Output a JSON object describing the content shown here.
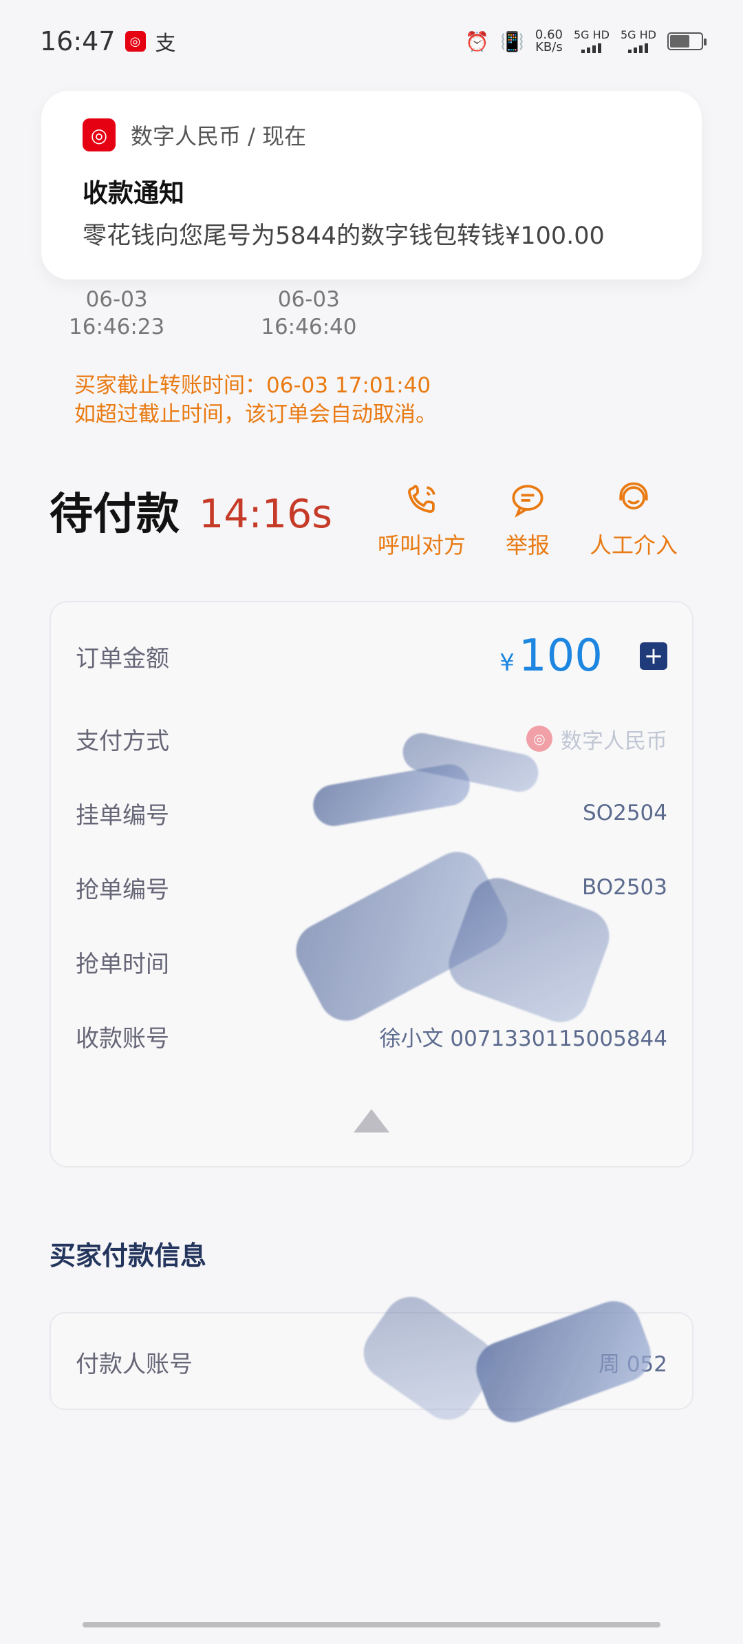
{
  "status_bar": {
    "time": "16:47",
    "app_badge": "",
    "alipay_char": "支",
    "speed_value": "0.60",
    "speed_unit": "KB/s",
    "sim1_label": "5G HD",
    "sim2_label": "5G HD"
  },
  "notification": {
    "app_name": "数字人民币 / 现在",
    "title": "收款通知",
    "body": "零花钱向您尾号为5844的数字钱包转钱¥100.00"
  },
  "times": [
    {
      "date": "06-03",
      "time": "16:46:23"
    },
    {
      "date": "06-03",
      "time": "16:46:40"
    }
  ],
  "deadline": {
    "line1": "买家截止转账时间：06-03 17:01:40",
    "line2": "如超过截止时间，该订单会自动取消。"
  },
  "order_status": {
    "title": "待付款",
    "countdown": "14:16s",
    "actions": [
      {
        "label": "呼叫对方"
      },
      {
        "label": "举报"
      },
      {
        "label": "人工介入"
      }
    ]
  },
  "order_card": {
    "amount_label": "订单金额",
    "currency": "¥",
    "amount": "100",
    "payment_label": "支付方式",
    "payment_value": "数字人民币",
    "listing_label": "挂单编号",
    "listing_value": "SO2504",
    "grab_label": "抢单编号",
    "grab_value": "BO2503",
    "grab_time_label": "抢单时间",
    "grab_time_value": "",
    "account_label": "收款账号",
    "account_value": "徐小文 0071330115005844"
  },
  "buyer_section": {
    "title": "买家付款信息",
    "payer_label": "付款人账号",
    "payer_value": "周 052"
  }
}
